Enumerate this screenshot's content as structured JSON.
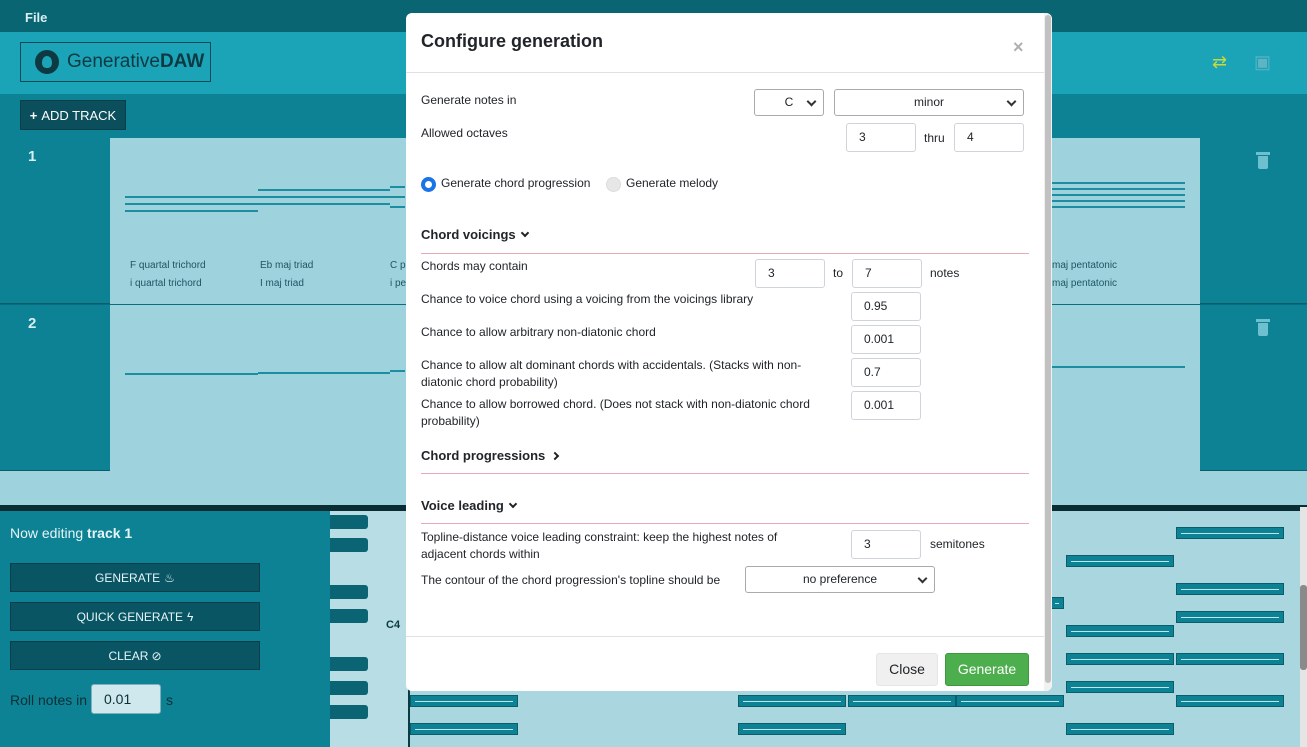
{
  "menu": {
    "file": "File"
  },
  "header": {
    "logo_text": "Generative",
    "logo_bold": "DAW"
  },
  "toolbar": {
    "add_track": "ADD TRACK"
  },
  "tracks": [
    {
      "number": "1",
      "chords": [
        "F quartal trichord",
        "Eb maj triad",
        "C p",
        "maj pentatonic"
      ],
      "numerals": [
        "i quartal trichord",
        "I maj triad",
        "i pe",
        "maj pentatonic"
      ]
    },
    {
      "number": "2"
    }
  ],
  "editor": {
    "now_editing": "Now editing ",
    "track_name": "track 1",
    "generate": "GENERATE",
    "quick_generate": "QUICK GENERATE",
    "clear": "CLEAR",
    "roll_label": "Roll notes in",
    "roll_value": "0.01",
    "roll_unit": "s",
    "c4": "C4"
  },
  "modal": {
    "title": "Configure generation",
    "generate_notes_label": "Generate notes in",
    "key": "C",
    "scale": "minor",
    "octaves_label": "Allowed octaves",
    "octave_from": "3",
    "thru": "thru",
    "octave_to": "4",
    "mode_chord": "Generate chord progression",
    "mode_melody": "Generate melody",
    "chord_voicings": {
      "heading": "Chord voicings",
      "contain_label": "Chords may contain",
      "contain_min": "3",
      "to": "to",
      "contain_max": "7",
      "notes": "notes",
      "voicing_label": "Chance to voice chord using a voicing from the voicings library",
      "voicing_value": "0.95",
      "nondiatonic_label": "Chance to allow arbitrary non-diatonic chord",
      "nondiatonic_value": "0.001",
      "altdom_label": "Chance to allow alt dominant chords with accidentals. (Stacks with non-diatonic chord probability)",
      "altdom_value": "0.7",
      "borrowed_label": "Chance to allow borrowed chord. (Does not stack with non-diatonic chord probability)",
      "borrowed_value": "0.001"
    },
    "chord_progressions": {
      "heading": "Chord progressions"
    },
    "voice_leading": {
      "heading": "Voice leading",
      "topline_label": "Topline-distance voice leading constraint: keep the highest notes of adjacent chords within",
      "topline_value": "3",
      "semitones": "semitones",
      "contour_label": "The contour of the chord progression's topline should be",
      "contour_value": "no preference"
    },
    "close_button": "Close",
    "generate_button": "Generate"
  },
  "colors": {
    "accent": "#1a73e8",
    "success": "#4cae4c",
    "teal": "#0d8294"
  }
}
